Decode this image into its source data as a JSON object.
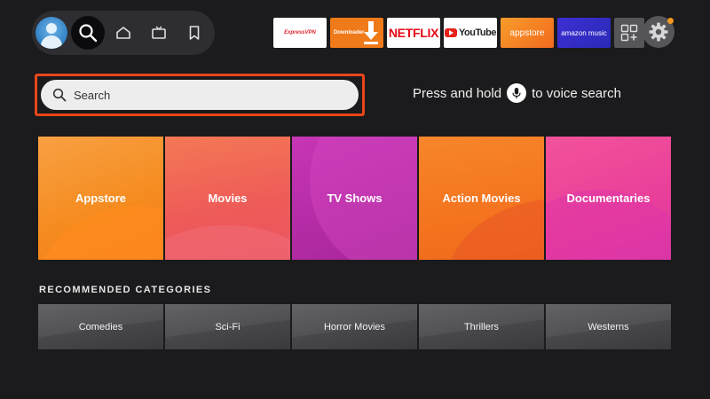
{
  "nav": {
    "items": [
      {
        "name": "search",
        "icon": "search-icon"
      },
      {
        "name": "home",
        "icon": "home-icon"
      },
      {
        "name": "live",
        "icon": "tv-icon"
      },
      {
        "name": "watchlist",
        "icon": "bookmark-icon"
      }
    ],
    "active": "search"
  },
  "apps": {
    "expressvpn": "ExpressVPN",
    "downloader": "Downloader",
    "netflix": "NETFLIX",
    "youtube": "YouTube",
    "appstore": "appstore",
    "amazon_music": "amazon music"
  },
  "search": {
    "placeholder": "Search",
    "voice_hint_before": "Press and hold",
    "voice_hint_after": "to voice search"
  },
  "categories": [
    {
      "label": "Appstore"
    },
    {
      "label": "Movies"
    },
    {
      "label": "TV Shows"
    },
    {
      "label": "Action Movies"
    },
    {
      "label": "Documentaries"
    }
  ],
  "recommended": {
    "title": "RECOMMENDED CATEGORIES",
    "items": [
      {
        "label": "Comedies"
      },
      {
        "label": "Sci-Fi"
      },
      {
        "label": "Horror Movies"
      },
      {
        "label": "Thrillers"
      },
      {
        "label": "Westerns"
      }
    ]
  },
  "colors": {
    "focus_outline": "#e8461a",
    "notification_dot": "#f29a1e",
    "background": "#1b1a1c"
  }
}
